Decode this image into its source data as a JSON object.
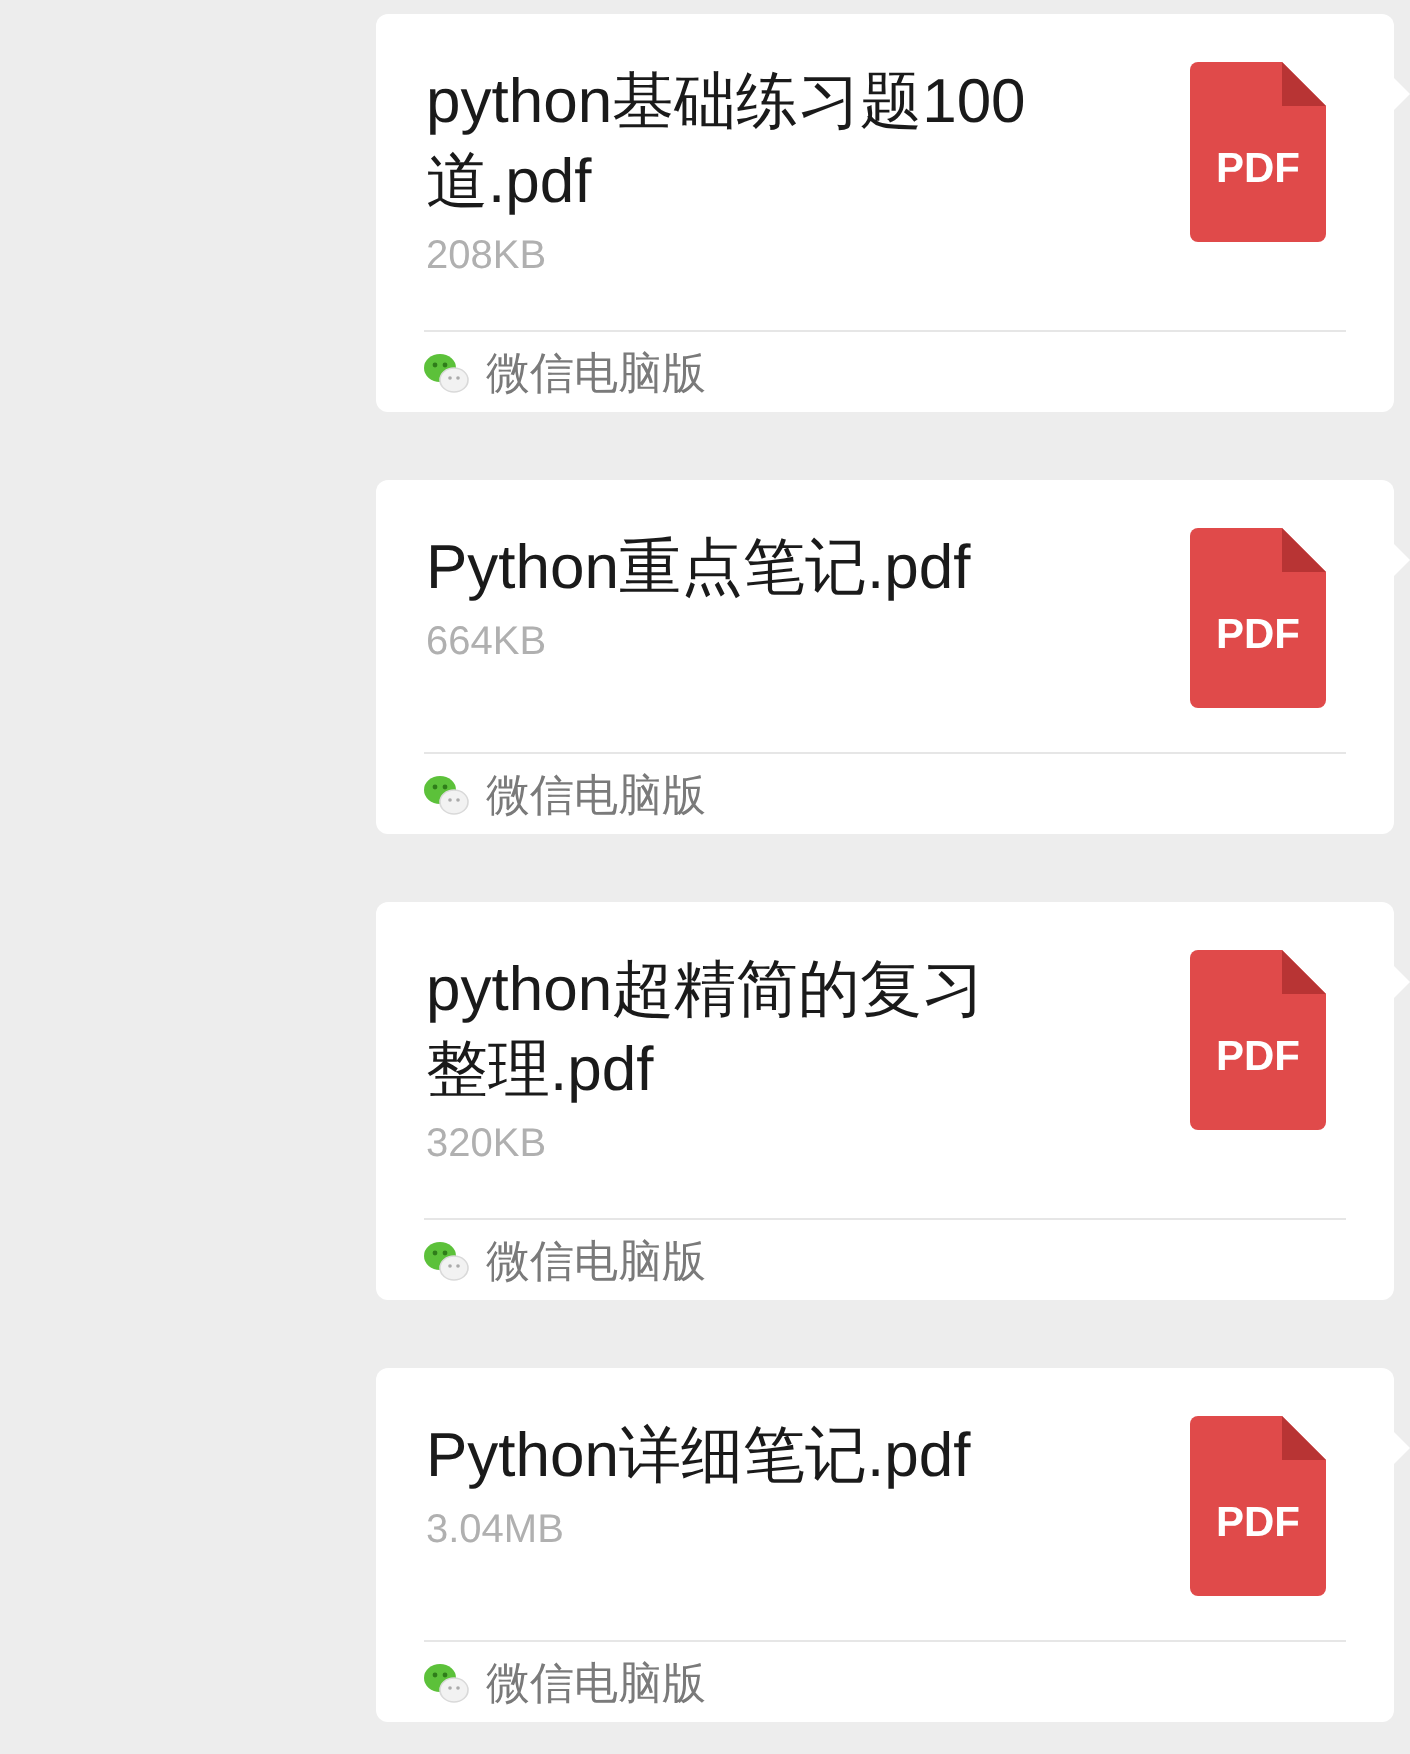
{
  "messages": [
    {
      "file_name": "python基础练习题100道.pdf",
      "size": "208KB",
      "file_type": "PDF",
      "source": "微信电脑版"
    },
    {
      "file_name": "Python重点笔记.pdf",
      "size": "664KB",
      "file_type": "PDF",
      "source": "微信电脑版"
    },
    {
      "file_name": "python超精简的复习整理.pdf",
      "size": "320KB",
      "file_type": "PDF",
      "source": "微信电脑版"
    },
    {
      "file_name": "Python详细笔记.pdf",
      "size": "3.04MB",
      "file_type": "PDF",
      "source": "微信电脑版"
    }
  ]
}
